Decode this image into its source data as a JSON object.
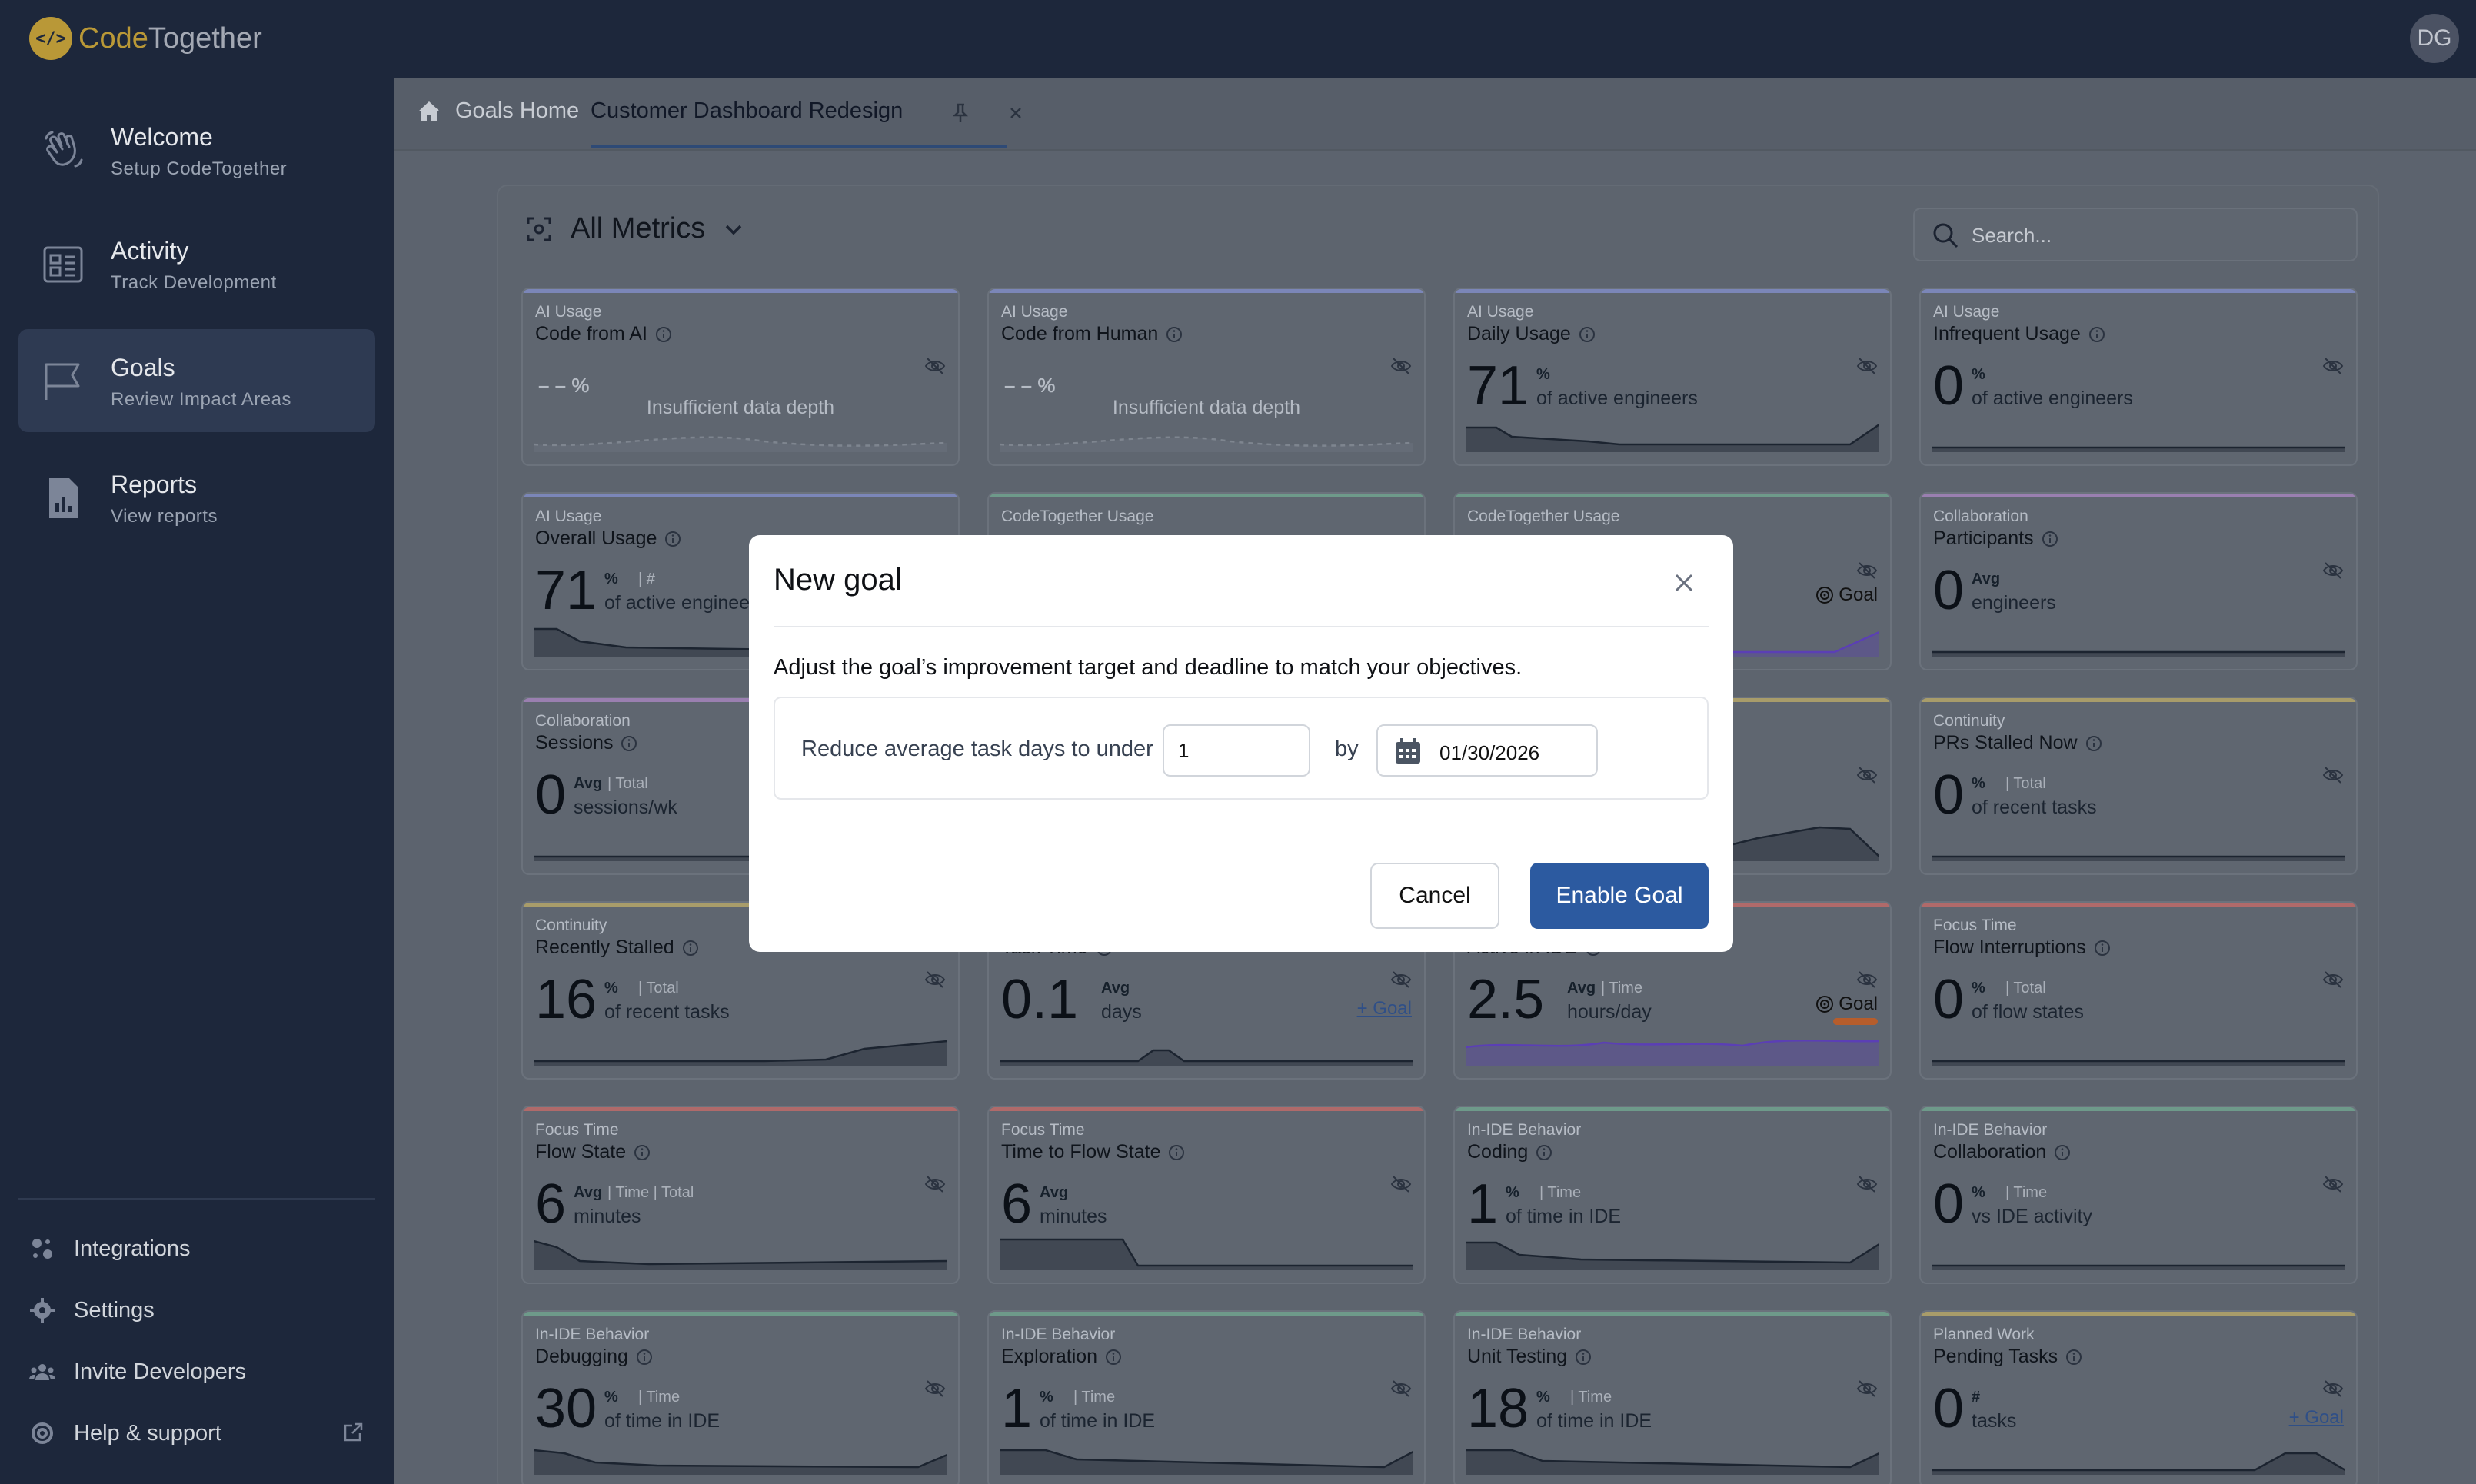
{
  "app": {
    "logo_text_1": "Code",
    "logo_text_2": "Together",
    "avatar": "DG"
  },
  "sidebar": {
    "items": [
      {
        "title": "Welcome",
        "sub": "Setup CodeTogether"
      },
      {
        "title": "Activity",
        "sub": "Track Development"
      },
      {
        "title": "Goals",
        "sub": "Review Impact Areas"
      },
      {
        "title": "Reports",
        "sub": "View reports"
      }
    ],
    "footer": [
      "Integrations",
      "Settings",
      "Invite Developers",
      "Help & support"
    ]
  },
  "tabs": {
    "home": "Goals Home",
    "active": "Customer Dashboard Redesign"
  },
  "metrics": {
    "title": "All Metrics",
    "search_placeholder": "Search..."
  },
  "cards": [
    {
      "cat": "AI Usage",
      "title": "Code from AI",
      "insufficient": "Insufficient data depth",
      "placeholder": "– – %",
      "color": "#7b86b8"
    },
    {
      "cat": "AI Usage",
      "title": "Code from Human",
      "insufficient": "Insufficient data depth",
      "placeholder": "– – %",
      "color": "#7b86b8"
    },
    {
      "cat": "AI Usage",
      "title": "Daily Usage",
      "value": "71",
      "unit": "%",
      "desc": "of active engineers",
      "color": "#7b86b8"
    },
    {
      "cat": "AI Usage",
      "title": "Infrequent Usage",
      "value": "0",
      "unit": "%",
      "desc": "of active engineers",
      "color": "#7b86b8"
    },
    {
      "cat": "AI Usage",
      "title": "Overall Usage",
      "value": "71",
      "unit": "%",
      "tot": "#",
      "desc": "of active engineers",
      "color": "#7b86b8"
    },
    {
      "cat": "CodeTogether Usage",
      "title": "",
      "color": "#6e9a8a"
    },
    {
      "cat": "CodeTogether Usage",
      "title": "",
      "goal": "Goal",
      "color": "#6e9a8a"
    },
    {
      "cat": "Collaboration",
      "title": "Participants",
      "value": "0",
      "unit": "Avg",
      "desc": "engineers",
      "color": "#9a7fb0"
    },
    {
      "cat": "Collaboration",
      "title": "Sessions",
      "value": "0",
      "unit": "Avg",
      "tot": "Total",
      "desc": "sessions/wk",
      "color": "#9a7fb0"
    },
    {
      "cat": "",
      "title": "",
      "color": "#a89c6a"
    },
    {
      "cat": "",
      "title": "",
      "color": "#a89c6a"
    },
    {
      "cat": "Continuity",
      "title": "PRs Stalled Now",
      "value": "0",
      "unit": "%",
      "tot": "Total",
      "desc": "of recent tasks",
      "color": "#a89c6a"
    },
    {
      "cat": "Continuity",
      "title": "Recently Stalled",
      "value": "16",
      "unit": "%",
      "tot": "Total",
      "desc": "of recent tasks",
      "color": "#a89c6a"
    },
    {
      "cat": "",
      "title": "Task Time",
      "value": "0.1",
      "unit": "Avg",
      "desc": "days",
      "goal_link": "+ Goal",
      "color": "#a89c6a"
    },
    {
      "cat": "",
      "title": "Active in IDE",
      "value": "2.5",
      "unit": "Avg",
      "tot": "Time",
      "desc": "hours/day",
      "goal": "Goal",
      "color": "#b06a6a"
    },
    {
      "cat": "Focus Time",
      "title": "Flow Interruptions",
      "value": "0",
      "unit": "%",
      "tot": "Total",
      "desc": "of flow states",
      "color": "#b06a6a"
    },
    {
      "cat": "Focus Time",
      "title": "Flow State",
      "value": "6",
      "unit": "Avg",
      "tot": "Time   |   Total",
      "desc": "minutes",
      "color": "#b06a6a"
    },
    {
      "cat": "Focus Time",
      "title": "Time to Flow State",
      "value": "6",
      "unit": "Avg",
      "desc": "minutes",
      "color": "#b06a6a"
    },
    {
      "cat": "In-IDE Behavior",
      "title": "Coding",
      "value": "1",
      "unit": "%",
      "tot": "Time",
      "desc": "of time in IDE",
      "color": "#6e9a8a"
    },
    {
      "cat": "In-IDE Behavior",
      "title": "Collaboration",
      "value": "0",
      "unit": "%",
      "tot": "Time",
      "desc": "vs IDE activity",
      "color": "#6e9a8a"
    },
    {
      "cat": "In-IDE Behavior",
      "title": "Debugging",
      "value": "30",
      "unit": "%",
      "tot": "Time",
      "desc": "of time in IDE",
      "color": "#6e9a8a"
    },
    {
      "cat": "In-IDE Behavior",
      "title": "Exploration",
      "value": "1",
      "unit": "%",
      "tot": "Time",
      "desc": "of time in IDE",
      "color": "#6e9a8a"
    },
    {
      "cat": "In-IDE Behavior",
      "title": "Unit Testing",
      "value": "18",
      "unit": "%",
      "tot": "Time",
      "desc": "of time in IDE",
      "color": "#6e9a8a"
    },
    {
      "cat": "Planned Work",
      "title": "Pending Tasks",
      "value": "0",
      "unit": "#",
      "desc": "tasks",
      "goal_link": "+ Goal",
      "color": "#a89c6a"
    }
  ],
  "modal": {
    "title": "New goal",
    "description": "Adjust the goal’s improvement target and deadline to match your objectives.",
    "goal_label": "Reduce average task days to under",
    "goal_value": "1",
    "by": "by",
    "date": "01/30/2026",
    "cancel": "Cancel",
    "enable": "Enable Goal"
  }
}
